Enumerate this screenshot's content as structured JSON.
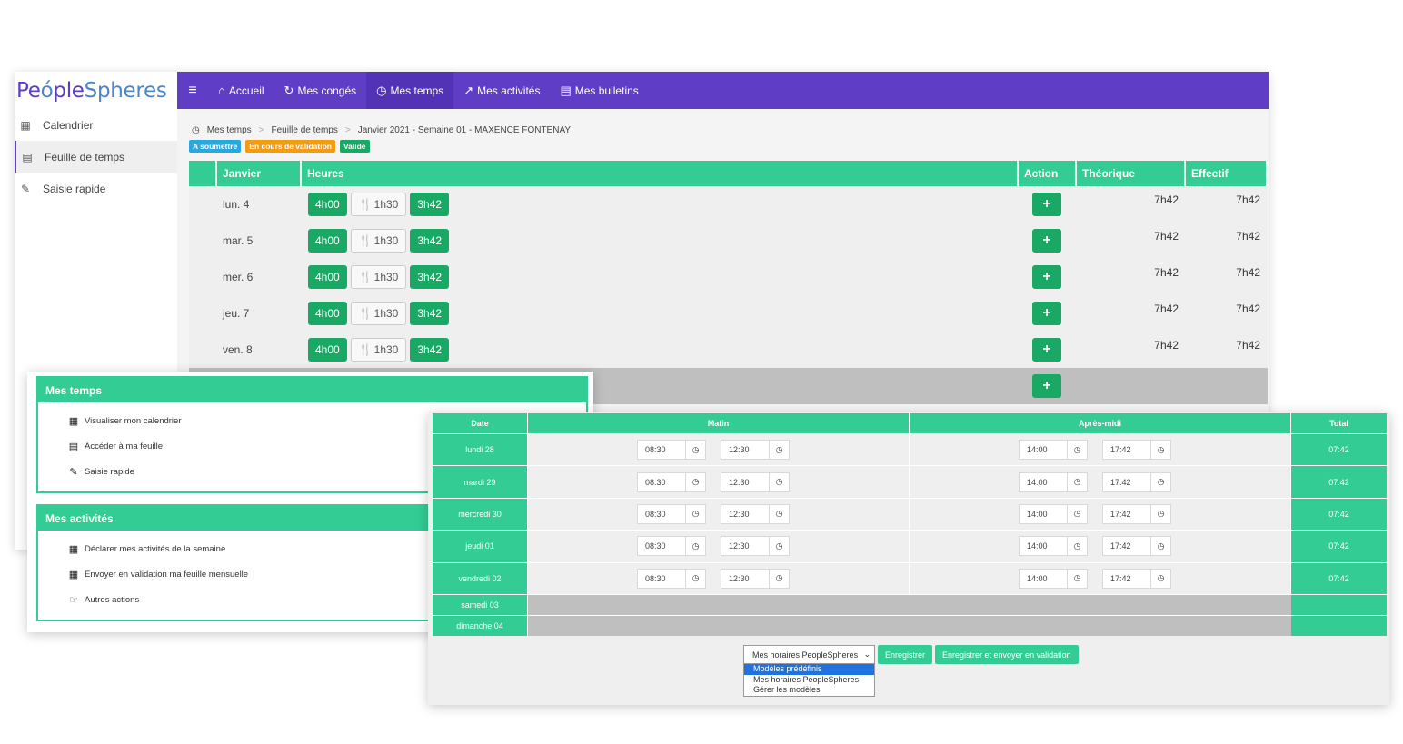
{
  "app": {
    "logo_part1": "Pe",
    "logo_o": "ó",
    "logo_part2": "ple",
    "logo_part3": "Spheres"
  },
  "topnav": {
    "items": [
      {
        "label": "Accueil",
        "icon": "home-icon"
      },
      {
        "label": "Mes congés",
        "icon": "refresh-icon"
      },
      {
        "label": "Mes temps",
        "icon": "clock-icon"
      },
      {
        "label": "Mes activités",
        "icon": "chart-line-icon"
      },
      {
        "label": "Mes bulletins",
        "icon": "document-icon"
      }
    ]
  },
  "sidebar": {
    "items": [
      {
        "label": "Calendrier",
        "icon": "calendar-icon"
      },
      {
        "label": "Feuille de temps",
        "icon": "file-icon"
      },
      {
        "label": "Saisie rapide",
        "icon": "pencil-icon"
      }
    ]
  },
  "breadcrumb": {
    "items": [
      "Mes temps",
      "Feuille de temps",
      "Janvier 2021 - Semaine 01 - MAXENCE FONTENAY"
    ]
  },
  "badges": [
    {
      "label": "A soumettre",
      "color": "#29a8e0"
    },
    {
      "label": "En cours de validation",
      "color": "#f39c12"
    },
    {
      "label": "Validé",
      "color": "#1aa865"
    }
  ],
  "week_table": {
    "headers": {
      "month": "Janvier",
      "hours": "Heures",
      "action": "Action",
      "theoretical": "Théorique",
      "actual": "Effectif"
    },
    "rows": [
      {
        "day": "lun. 4",
        "morning": "4h00",
        "lunch": "1h30",
        "afternoon": "3h42",
        "theoretical": "7h42",
        "actual": "7h42"
      },
      {
        "day": "mar. 5",
        "morning": "4h00",
        "lunch": "1h30",
        "afternoon": "3h42",
        "theoretical": "7h42",
        "actual": "7h42"
      },
      {
        "day": "mer. 6",
        "morning": "4h00",
        "lunch": "1h30",
        "afternoon": "3h42",
        "theoretical": "7h42",
        "actual": "7h42"
      },
      {
        "day": "jeu. 7",
        "morning": "4h00",
        "lunch": "1h30",
        "afternoon": "3h42",
        "theoretical": "7h42",
        "actual": "7h42"
      },
      {
        "day": "ven. 8",
        "morning": "4h00",
        "lunch": "1h30",
        "afternoon": "3h42",
        "theoretical": "7h42",
        "actual": "7h42"
      }
    ],
    "plus_label": "+"
  },
  "mes_temps_panel": {
    "title": "Mes temps",
    "items": [
      {
        "label": "Visualiser mon calendrier",
        "icon": "calendar-icon"
      },
      {
        "label": "Accéder à ma feuille",
        "icon": "file-icon"
      },
      {
        "label": "Saisie rapide",
        "icon": "pencil-icon"
      }
    ]
  },
  "mes_activites_panel": {
    "title": "Mes activités",
    "items": [
      {
        "label": "Déclarer mes activités de la semaine",
        "icon": "calendar-icon"
      },
      {
        "label": "Envoyer en validation ma feuille mensuelle",
        "icon": "calendar-icon"
      },
      {
        "label": "Autres actions",
        "icon": "hand-pointer-icon"
      }
    ]
  },
  "schedule": {
    "headers": {
      "date": "Date",
      "morning": "Matin",
      "afternoon": "Après-midi",
      "total": "Total"
    },
    "rows": [
      {
        "date": "lundi 28",
        "m_start": "08:30",
        "m_end": "12:30",
        "a_start": "14:00",
        "a_end": "17:42",
        "total": "07:42"
      },
      {
        "date": "mardi 29",
        "m_start": "08:30",
        "m_end": "12:30",
        "a_start": "14:00",
        "a_end": "17:42",
        "total": "07:42"
      },
      {
        "date": "mercredi 30",
        "m_start": "08:30",
        "m_end": "12:30",
        "a_start": "14:00",
        "a_end": "17:42",
        "total": "07:42"
      },
      {
        "date": "jeudi 01",
        "m_start": "08:30",
        "m_end": "12:30",
        "a_start": "14:00",
        "a_end": "17:42",
        "total": "07:42"
      },
      {
        "date": "vendredi 02",
        "m_start": "08:30",
        "m_end": "12:30",
        "a_start": "14:00",
        "a_end": "17:42",
        "total": "07:42"
      }
    ],
    "weekend": [
      {
        "date": "samedi 03"
      },
      {
        "date": "dimanche 04"
      }
    ]
  },
  "footer": {
    "select_value": "Mes horaires PeopleSpheres",
    "save_label": "Enregistrer",
    "save_submit_label": "Enregistrer et envoyer en validation",
    "dropdown_options": [
      "Modèles prédéfinis",
      "Mes horaires PeopleSpheres",
      "Gérer les modèles"
    ]
  }
}
